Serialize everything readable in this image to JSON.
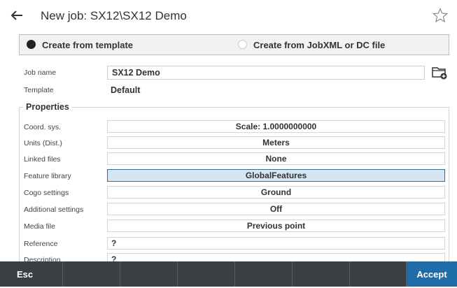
{
  "header": {
    "title": "New job:  SX12\\SX12 Demo"
  },
  "mode": {
    "option1_label": "Create from template",
    "option2_label": "Create from JobXML or DC file"
  },
  "form": {
    "job_name_label": "Job name",
    "job_name_value": "SX12 Demo",
    "template_label": "Template",
    "template_value": "Default"
  },
  "properties": {
    "legend": "Properties",
    "rows": [
      {
        "label": "Coord. sys.",
        "value": "Scale:  1.0000000000"
      },
      {
        "label": "Units (Dist.)",
        "value": "Meters"
      },
      {
        "label": "Linked files",
        "value": "None"
      },
      {
        "label": "Feature library",
        "value": "GlobalFeatures"
      },
      {
        "label": "Cogo settings",
        "value": "Ground"
      },
      {
        "label": "Additional settings",
        "value": "Off"
      },
      {
        "label": "Media file",
        "value": "Previous point"
      },
      {
        "label": "Reference",
        "value": "?"
      },
      {
        "label": "Description",
        "value": "?"
      }
    ]
  },
  "footer": {
    "esc_label": "Esc",
    "accept_label": "Accept"
  },
  "colors": {
    "footer_bg": "#3a3f44",
    "accent": "#1e6da8",
    "selected_bg": "#d5e6f2"
  }
}
